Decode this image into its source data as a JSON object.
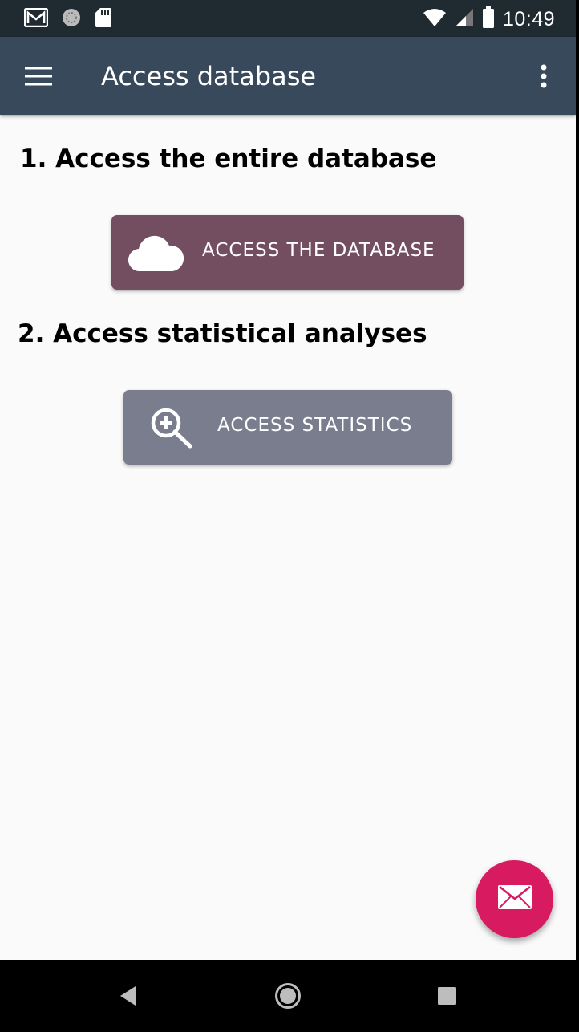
{
  "status_bar": {
    "time": "10:49",
    "icons": [
      "gmail-icon",
      "sync-icon",
      "sd-card-icon",
      "wifi-icon",
      "signal-icon",
      "battery-icon"
    ]
  },
  "app_bar": {
    "title": "Access database",
    "menu_icon": "hamburger-menu-icon",
    "overflow_icon": "more-vertical-icon",
    "background": "#37495a"
  },
  "content": {
    "section1_heading": "1. Access the entire database",
    "access_db_button": {
      "label": "ACCESS THE DATABASE",
      "icon": "cloud-icon",
      "color": "#734d60"
    },
    "section2_heading": "2. Access statistical analyses",
    "access_stats_button": {
      "label": "ACCESS STATISTICS",
      "icon": "zoom-in-icon",
      "color": "#7a7d8e"
    }
  },
  "fab": {
    "icon": "email-icon",
    "color": "#d81b60"
  },
  "nav_bar": {
    "buttons": [
      "back-icon",
      "home-icon",
      "recents-icon"
    ]
  }
}
